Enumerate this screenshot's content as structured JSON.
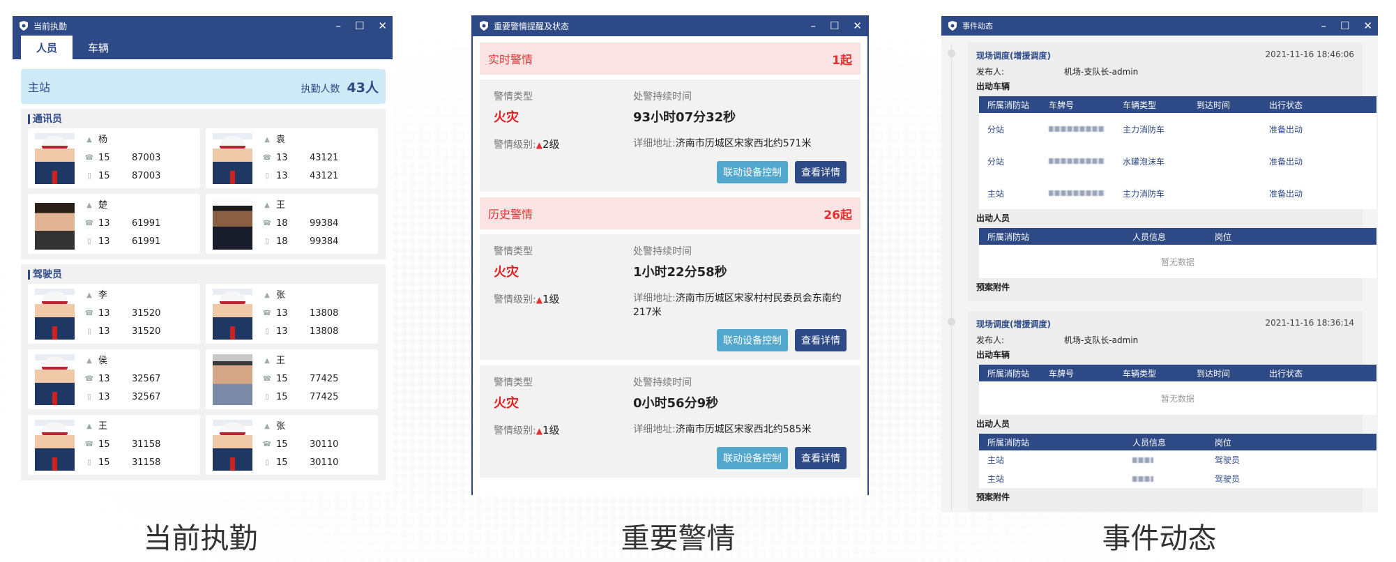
{
  "win1": {
    "title": "当前执勤",
    "tabs": [
      "人员",
      "车辆"
    ],
    "station": {
      "name": "主站",
      "count_label": "执勤人数",
      "count": "43人"
    },
    "groups": [
      {
        "name": "通讯员",
        "people": [
          {
            "name": "杨",
            "phone": "15",
            "tail": "87003",
            "phone2": "15",
            "tail2": "87003",
            "avatar": "uniform"
          },
          {
            "name": "袁",
            "phone": "13",
            "tail": "43121",
            "phone2": "13",
            "tail2": "43121",
            "avatar": "uniform"
          },
          {
            "name": "楚",
            "phone": "13",
            "tail": "61991",
            "phone2": "13",
            "tail2": "61991",
            "avatar": "photo"
          },
          {
            "name": "王",
            "phone": "18",
            "tail": "99384",
            "phone2": "18",
            "tail2": "99384",
            "avatar": "suit"
          }
        ]
      },
      {
        "name": "驾驶员",
        "people": [
          {
            "name": "李",
            "phone": "13",
            "tail": "31520",
            "phone2": "13",
            "tail2": "31520",
            "avatar": "uniform"
          },
          {
            "name": "张",
            "phone": "13",
            "tail": "13808",
            "phone2": "13",
            "tail2": "13808",
            "avatar": "uniform"
          },
          {
            "name": "侯",
            "phone": "13",
            "tail": "32567",
            "phone2": "13",
            "tail2": "32567",
            "avatar": "uniform"
          },
          {
            "name": "王",
            "phone": "15",
            "tail": "77425",
            "phone2": "15",
            "tail2": "77425",
            "avatar": "grey"
          },
          {
            "name": "王",
            "phone": "15",
            "tail": "31158",
            "phone2": "15",
            "tail2": "31158",
            "avatar": "uniform"
          },
          {
            "name": "张",
            "phone": "15",
            "tail": "30110",
            "phone2": "15",
            "tail2": "30110",
            "avatar": "uniform"
          }
        ]
      }
    ],
    "caption": "当前执勤"
  },
  "win2": {
    "title": "重要警情提醒及状态",
    "realtime": {
      "label": "实时警情",
      "count": "1起"
    },
    "history": {
      "label": "历史警情",
      "count": "26起"
    },
    "labels": {
      "type": "警情类型",
      "duration": "处警持续时间",
      "level": "警情级别:",
      "address": "详细地址:",
      "btn_device": "联动设备控制",
      "btn_detail": "查看详情"
    },
    "alerts": [
      {
        "type": "火灾",
        "duration": "93小时07分32秒",
        "level": "2级",
        "address": "济南市历城区宋家西北约571米"
      },
      {
        "type": "火灾",
        "duration": "1小时22分58秒",
        "level": "1级",
        "address": "济南市历城区宋家村村民委员会东南约217米"
      },
      {
        "type": "火灾",
        "duration": "0小时56分9秒",
        "level": "1级",
        "address": "济南市历城区宋家西北约585米"
      }
    ],
    "caption": "重要警情"
  },
  "win3": {
    "title": "事件动态",
    "labels": {
      "publisher": "发布人:",
      "vehicles": "出动车辆",
      "personnel": "出动人员",
      "attachments": "预案附件",
      "empty": "暂无数据"
    },
    "vehicle_headers": [
      "所属消防站",
      "车牌号",
      "车辆类型",
      "到达时间",
      "出行状态"
    ],
    "person_headers": [
      "所属消防站",
      "人员信息",
      "岗位"
    ],
    "events": [
      {
        "title": "现场调度(增援调度)",
        "time": "2021-11-16 18:46:06",
        "publisher": "机场-支队长-admin",
        "vehicles": [
          {
            "station": "分站",
            "type": "主力消防车",
            "status": "准备出动"
          },
          {
            "station": "分站",
            "type": "水罐泡沫车",
            "status": "准备出动"
          },
          {
            "station": "主站",
            "type": "主力消防车",
            "status": "准备出动"
          }
        ],
        "persons": []
      },
      {
        "title": "现场调度(增援调度)",
        "time": "2021-11-16 18:36:14",
        "publisher": "机场-支队长-admin",
        "vehicles": [],
        "persons": [
          {
            "station": "主站",
            "post": "驾驶员"
          },
          {
            "station": "主站",
            "post": "驾驶员"
          }
        ]
      }
    ],
    "caption": "事件动态"
  },
  "colors": {
    "accent": "#2d4a86",
    "alert": "#e23030",
    "station_bg": "#cfeaf7",
    "btn_light": "#52a8cc"
  }
}
